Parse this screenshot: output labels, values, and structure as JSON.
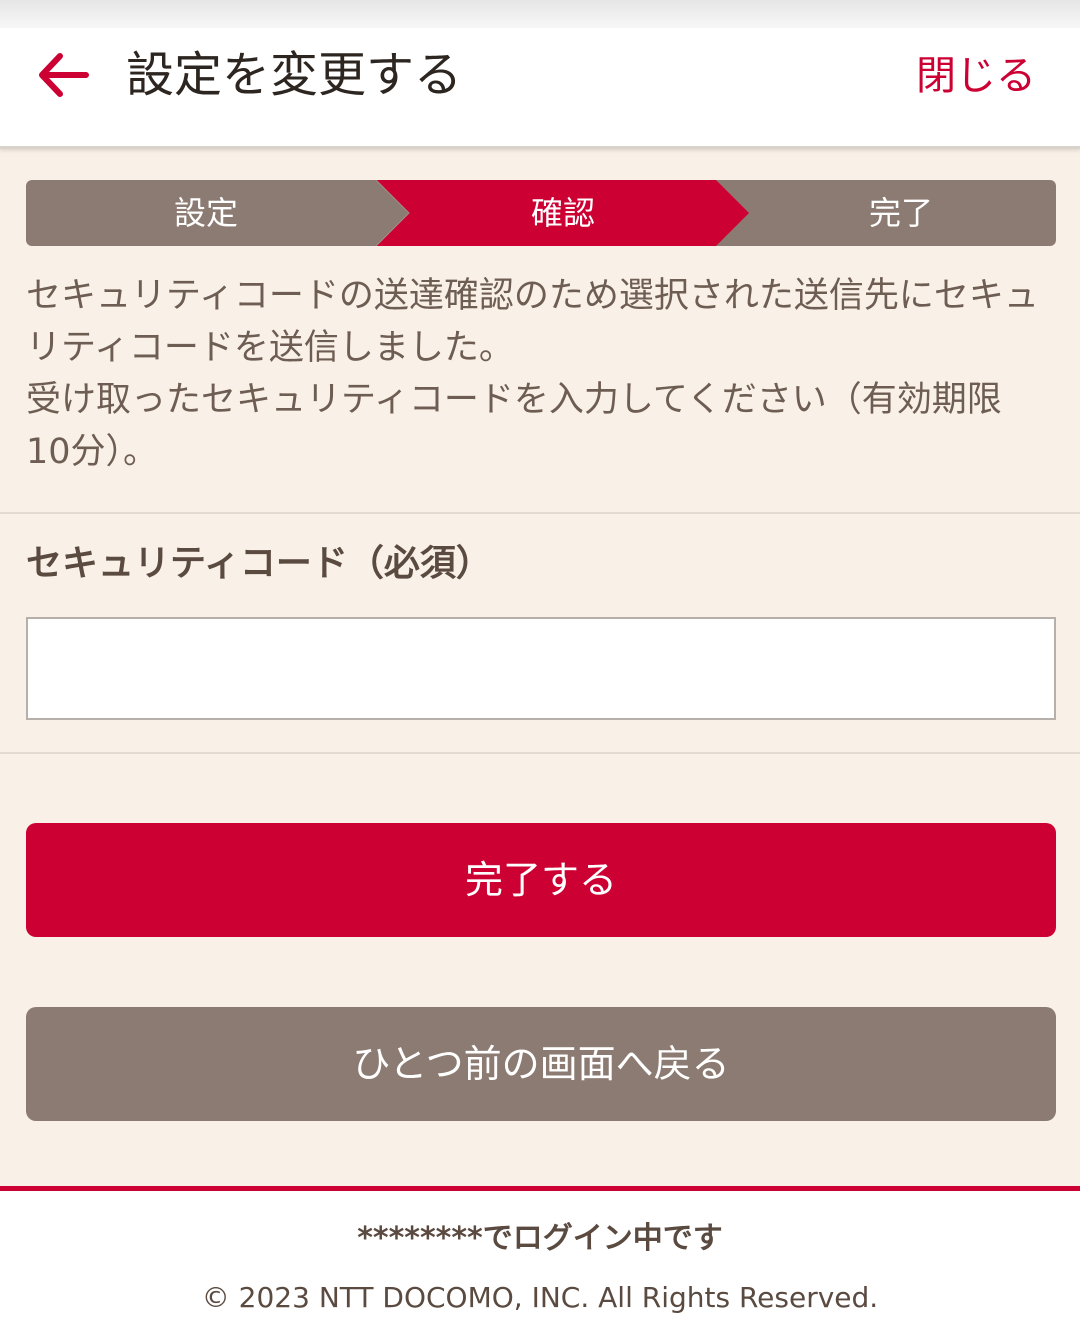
{
  "header": {
    "back_icon": "arrow-left-icon",
    "title": "設定を変更する",
    "close_label": "閉じる",
    "accent_color": "#cc0033"
  },
  "steps": {
    "items": [
      {
        "label": "設定",
        "active": false
      },
      {
        "label": "確認",
        "active": true
      },
      {
        "label": "完了",
        "active": false
      }
    ],
    "active_color": "#cc0033",
    "inactive_color": "#8c7b72"
  },
  "description": {
    "line1": "セキュリティコードの送達確認のため選択された送信先にセキュリティコードを送信しました。",
    "line2": "受け取ったセキュリティコードを入力してください（有効期限 10分）。"
  },
  "form": {
    "label": "セキュリティコード（必須）",
    "value": "",
    "placeholder": ""
  },
  "buttons": {
    "submit_label": "完了する",
    "back_label": "ひとつ前の画面へ戻る"
  },
  "footer": {
    "login_status": "********でログイン中です",
    "copyright": "© 2023 NTT DOCOMO, INC. All Rights Reserved."
  }
}
